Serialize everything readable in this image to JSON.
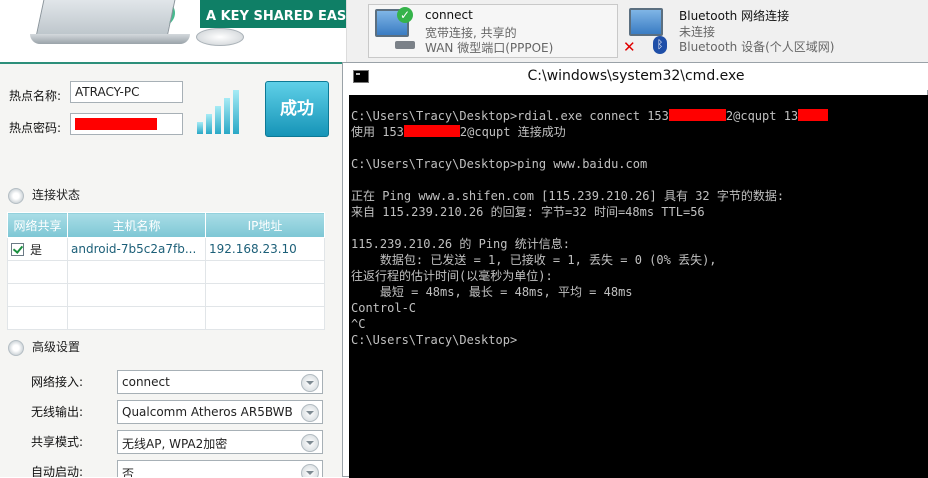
{
  "app": {
    "slogan": "A KEY SHARED EASILY",
    "hotspot_name_label": "热点名称:",
    "hotspot_name_value": "ATRACY-PC",
    "hotspot_password_label": "热点密码:",
    "success_button": "成功",
    "connection_section": "连接状态",
    "table": {
      "columns": [
        "网络共享",
        "主机名称",
        "IP地址"
      ],
      "rows": [
        {
          "shared": "是",
          "host": "android-7b5c2a7fb...",
          "ip": "192.168.23.10"
        }
      ]
    },
    "advanced_section": "高级设置",
    "settings": {
      "network_access_label": "网络接入:",
      "network_access_value": "connect",
      "wireless_output_label": "无线输出:",
      "wireless_output_value": "Qualcomm Atheros AR5BWB",
      "share_mode_label": "共享模式:",
      "share_mode_value": "无线AP, WPA2加密",
      "auto_start_label": "自动启动:",
      "auto_start_value": "否"
    }
  },
  "network": {
    "conn1": {
      "name": "connect",
      "status": "宽带连接, 共享的",
      "device": "WAN 微型端口(PPPOE)"
    },
    "conn2": {
      "name": "Bluetooth 网络连接",
      "status": "未连接",
      "device": "Bluetooth 设备(个人区域网)"
    }
  },
  "cmd": {
    "title": "C:\\windows\\system32\\cmd.exe",
    "lines": {
      "l1a": "C:\\Users\\Tracy\\Desktop>rdial.exe connect 153",
      "l1b": "2@cqupt 13",
      "l2a": "使用 153",
      "l2b": "2@cqupt 连接成功",
      "l3": "C:\\Users\\Tracy\\Desktop>ping www.baidu.com",
      "l4": "正在 Ping www.a.shifen.com [115.239.210.26] 具有 32 字节的数据:",
      "l5": "来自 115.239.210.26 的回复: 字节=32 时间=48ms TTL=56",
      "l6": "115.239.210.26 的 Ping 统计信息:",
      "l7": "    数据包: 已发送 = 1, 已接收 = 1, 丢失 = 0 (0% 丢失),",
      "l8": "往返行程的估计时间(以毫秒为单位):",
      "l9": "    最短 = 48ms, 最长 = 48ms, 平均 = 48ms",
      "l10": "Control-C",
      "l11": "^C",
      "l12": "C:\\Users\\Tracy\\Desktop>"
    }
  },
  "colors": {
    "accent": "#0f7f66",
    "console_bg": "#000000",
    "redaction": "#ff0000"
  }
}
